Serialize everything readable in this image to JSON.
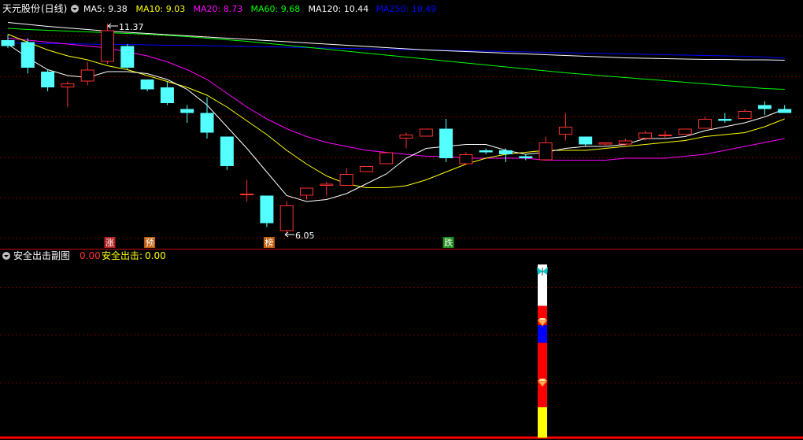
{
  "main_panel": {
    "stock_title": "天元股份",
    "period": "(日线)",
    "indicators": [
      {
        "label": "MA5:",
        "value": "9.38",
        "color": "#ffffff"
      },
      {
        "label": "MA10:",
        "value": "9.03",
        "color": "#ffff00"
      },
      {
        "label": "MA20:",
        "value": "8.73",
        "color": "#ff00ff"
      },
      {
        "label": "MA60:",
        "value": "9.68",
        "color": "#00ff00"
      },
      {
        "label": "MA120:",
        "value": "10.44",
        "color": "#ffffff"
      },
      {
        "label": "MA250:",
        "value": "10.49",
        "color": "#0000ff"
      }
    ],
    "high_marker": "11.37",
    "low_marker": "6.05",
    "badges": [
      {
        "text": "涨",
        "bg": "#b22222",
        "color": "#ffffff"
      },
      {
        "text": "预",
        "bg": "#c06010",
        "color": "#ffffff"
      },
      {
        "text": "榜",
        "bg": "#c06010",
        "color": "#ffffff"
      },
      {
        "text": "跌",
        "bg": "#1f8f1f",
        "color": "#ffffff"
      }
    ]
  },
  "sub_panel": {
    "title": "安全出击副图",
    "value1": "0.00",
    "label2": "安全出击:",
    "value2": "0.00"
  },
  "colors": {
    "up": "#ff3030",
    "down": "#54ffff",
    "grid": "#7a0000",
    "border": "#c00000",
    "bg": "#000000"
  },
  "chart_data": {
    "type": "candlestick",
    "y_range": [
      6.05,
      11.37
    ],
    "candles": [
      {
        "o": 10.95,
        "h": 11.1,
        "l": 10.75,
        "c": 10.8
      },
      {
        "o": 10.9,
        "h": 11.0,
        "l": 10.1,
        "c": 10.25
      },
      {
        "o": 10.15,
        "h": 10.2,
        "l": 9.65,
        "c": 9.75
      },
      {
        "o": 9.75,
        "h": 9.9,
        "l": 9.25,
        "c": 9.85
      },
      {
        "o": 9.9,
        "h": 10.4,
        "l": 9.8,
        "c": 10.2
      },
      {
        "o": 10.4,
        "h": 11.37,
        "l": 10.35,
        "c": 11.2
      },
      {
        "o": 10.8,
        "h": 10.85,
        "l": 10.2,
        "c": 10.25
      },
      {
        "o": 9.95,
        "h": 9.95,
        "l": 9.65,
        "c": 9.7
      },
      {
        "o": 9.75,
        "h": 9.9,
        "l": 9.3,
        "c": 9.35
      },
      {
        "o": 9.2,
        "h": 9.3,
        "l": 8.85,
        "c": 9.1
      },
      {
        "o": 9.1,
        "h": 9.5,
        "l": 8.45,
        "c": 8.6
      },
      {
        "o": 8.5,
        "h": 8.5,
        "l": 7.65,
        "c": 7.75
      },
      {
        "o": 7.05,
        "h": 7.4,
        "l": 6.85,
        "c": 7.05
      },
      {
        "o": 7.0,
        "h": 7.0,
        "l": 6.2,
        "c": 6.3
      },
      {
        "o": 6.1,
        "h": 6.85,
        "l": 6.05,
        "c": 6.75
      },
      {
        "o": 7.0,
        "h": 7.2,
        "l": 6.9,
        "c": 7.2
      },
      {
        "o": 7.25,
        "h": 7.35,
        "l": 7.0,
        "c": 7.3
      },
      {
        "o": 7.25,
        "h": 7.7,
        "l": 7.25,
        "c": 7.55
      },
      {
        "o": 7.6,
        "h": 7.75,
        "l": 7.6,
        "c": 7.75
      },
      {
        "o": 7.8,
        "h": 8.1,
        "l": 7.8,
        "c": 8.1
      },
      {
        "o": 8.45,
        "h": 8.6,
        "l": 8.2,
        "c": 8.55
      },
      {
        "o": 8.5,
        "h": 8.7,
        "l": 8.5,
        "c": 8.7
      },
      {
        "o": 8.7,
        "h": 8.95,
        "l": 7.85,
        "c": 7.95
      },
      {
        "o": 7.8,
        "h": 8.1,
        "l": 7.8,
        "c": 8.05
      },
      {
        "o": 8.15,
        "h": 8.2,
        "l": 8.05,
        "c": 8.1
      },
      {
        "o": 8.15,
        "h": 8.2,
        "l": 7.85,
        "c": 8.05
      },
      {
        "o": 8.0,
        "h": 8.05,
        "l": 7.9,
        "c": 7.95
      },
      {
        "o": 7.9,
        "h": 8.5,
        "l": 7.9,
        "c": 8.35
      },
      {
        "o": 8.55,
        "h": 9.1,
        "l": 8.4,
        "c": 8.75
      },
      {
        "o": 8.5,
        "h": 8.5,
        "l": 8.25,
        "c": 8.3
      },
      {
        "o": 8.3,
        "h": 8.35,
        "l": 8.25,
        "c": 8.35
      },
      {
        "o": 8.3,
        "h": 8.45,
        "l": 8.25,
        "c": 8.4
      },
      {
        "o": 8.45,
        "h": 8.65,
        "l": 8.4,
        "c": 8.6
      },
      {
        "o": 8.55,
        "h": 8.65,
        "l": 8.45,
        "c": 8.55
      },
      {
        "o": 8.55,
        "h": 8.7,
        "l": 8.55,
        "c": 8.7
      },
      {
        "o": 8.7,
        "h": 9.0,
        "l": 8.7,
        "c": 8.95
      },
      {
        "o": 8.95,
        "h": 9.1,
        "l": 8.85,
        "c": 8.9
      },
      {
        "o": 8.95,
        "h": 9.2,
        "l": 8.95,
        "c": 9.15
      },
      {
        "o": 9.3,
        "h": 9.4,
        "l": 9.05,
        "c": 9.2
      },
      {
        "o": 9.2,
        "h": 9.3,
        "l": 9.1,
        "c": 9.1
      }
    ],
    "ma5": [
      10.85,
      10.5,
      10.2,
      10.05,
      10.0,
      10.15,
      10.15,
      10.1,
      9.95,
      9.7,
      9.3,
      8.75,
      8.2,
      7.6,
      7.0,
      6.85,
      6.9,
      7.05,
      7.3,
      7.55,
      7.95,
      8.2,
      8.25,
      8.3,
      8.3,
      8.15,
      8.05,
      8.1,
      8.2,
      8.25,
      8.25,
      8.3,
      8.45,
      8.45,
      8.5,
      8.65,
      8.75,
      8.85,
      9.0,
      9.2
    ],
    "ma10": [
      11.1,
      10.9,
      10.7,
      10.55,
      10.45,
      10.3,
      10.2,
      10.05,
      9.9,
      9.75,
      9.55,
      9.25,
      8.9,
      8.55,
      8.15,
      7.8,
      7.5,
      7.3,
      7.2,
      7.2,
      7.25,
      7.4,
      7.6,
      7.8,
      7.95,
      8.05,
      8.1,
      8.15,
      8.15,
      8.15,
      8.2,
      8.25,
      8.3,
      8.35,
      8.4,
      8.5,
      8.55,
      8.6,
      8.75,
      8.95
    ],
    "ma20": [
      11.0,
      10.95,
      10.9,
      10.85,
      10.8,
      10.75,
      10.65,
      10.55,
      10.4,
      10.2,
      9.95,
      9.6,
      9.25,
      8.95,
      8.7,
      8.5,
      8.35,
      8.25,
      8.15,
      8.1,
      8.05,
      8.0,
      8.0,
      7.95,
      7.95,
      7.95,
      7.95,
      7.9,
      7.9,
      7.9,
      7.9,
      7.95,
      7.95,
      7.95,
      8.0,
      8.05,
      8.15,
      8.25,
      8.35,
      8.45
    ],
    "ma60": [
      11.25,
      11.22,
      11.2,
      11.18,
      11.16,
      11.14,
      11.12,
      11.1,
      11.07,
      11.04,
      11.0,
      10.96,
      10.92,
      10.87,
      10.82,
      10.77,
      10.72,
      10.67,
      10.62,
      10.57,
      10.52,
      10.47,
      10.42,
      10.37,
      10.32,
      10.27,
      10.22,
      10.17,
      10.12,
      10.08,
      10.04,
      10.0,
      9.96,
      9.92,
      9.88,
      9.84,
      9.8,
      9.76,
      9.72,
      9.7
    ],
    "ma120": [
      11.4,
      11.35,
      11.3,
      11.26,
      11.22,
      11.18,
      11.15,
      11.12,
      11.09,
      11.06,
      11.03,
      11.0,
      10.97,
      10.94,
      10.91,
      10.88,
      10.85,
      10.82,
      10.79,
      10.76,
      10.73,
      10.7,
      10.68,
      10.66,
      10.64,
      10.62,
      10.6,
      10.58,
      10.56,
      10.54,
      10.52,
      10.5,
      10.49,
      10.48,
      10.47,
      10.46,
      10.46,
      10.45,
      10.45,
      10.44
    ],
    "ma250": [
      10.88,
      10.87,
      10.86,
      10.86,
      10.85,
      10.84,
      10.84,
      10.83,
      10.82,
      10.82,
      10.81,
      10.8,
      10.79,
      10.78,
      10.77,
      10.76,
      10.75,
      10.74,
      10.73,
      10.72,
      10.71,
      10.7,
      10.69,
      10.68,
      10.67,
      10.66,
      10.65,
      10.64,
      10.63,
      10.62,
      10.61,
      10.6,
      10.59,
      10.58,
      10.57,
      10.56,
      10.55,
      10.54,
      10.52,
      10.49
    ],
    "ma_colors": {
      "ma5": "#ffffff",
      "ma10": "#ffff00",
      "ma20": "#ff00ff",
      "ma60": "#00ff00",
      "ma120": "#ffffff",
      "ma250": "#0000ff"
    },
    "signal_stack": [
      {
        "color": "#ffffff",
        "size": 0.18
      },
      {
        "color": "#ff0000",
        "size": 0.12
      },
      {
        "color": "#0000ff",
        "size": 0.11
      },
      {
        "color": "#ff0000",
        "size": 0.26
      },
      {
        "color": "#ff0000",
        "size": 0.14
      },
      {
        "color": "#ffff00",
        "size": 0.19
      }
    ]
  }
}
